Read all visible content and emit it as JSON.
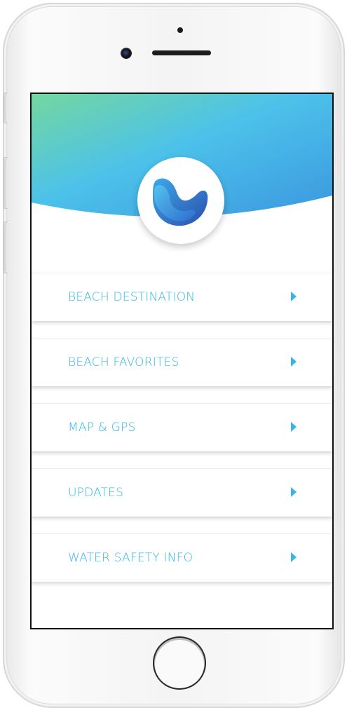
{
  "app": {
    "logo": "wave-logo-icon",
    "colors": {
      "header_gradient": [
        "#6fd3a0",
        "#4fc3ea",
        "#3a95e0"
      ],
      "accent": "#36b6e8"
    }
  },
  "menu": {
    "items": [
      {
        "label": "BEACH DESTINATION",
        "icon": "chevron-right-icon"
      },
      {
        "label": "BEACH FAVORITES",
        "icon": "chevron-right-icon"
      },
      {
        "label": "MAP & GPS",
        "icon": "chevron-right-icon"
      },
      {
        "label": "UPDATES",
        "icon": "chevron-right-icon"
      },
      {
        "label": "WATER SAFETY INFO",
        "icon": "chevron-right-icon"
      }
    ]
  }
}
